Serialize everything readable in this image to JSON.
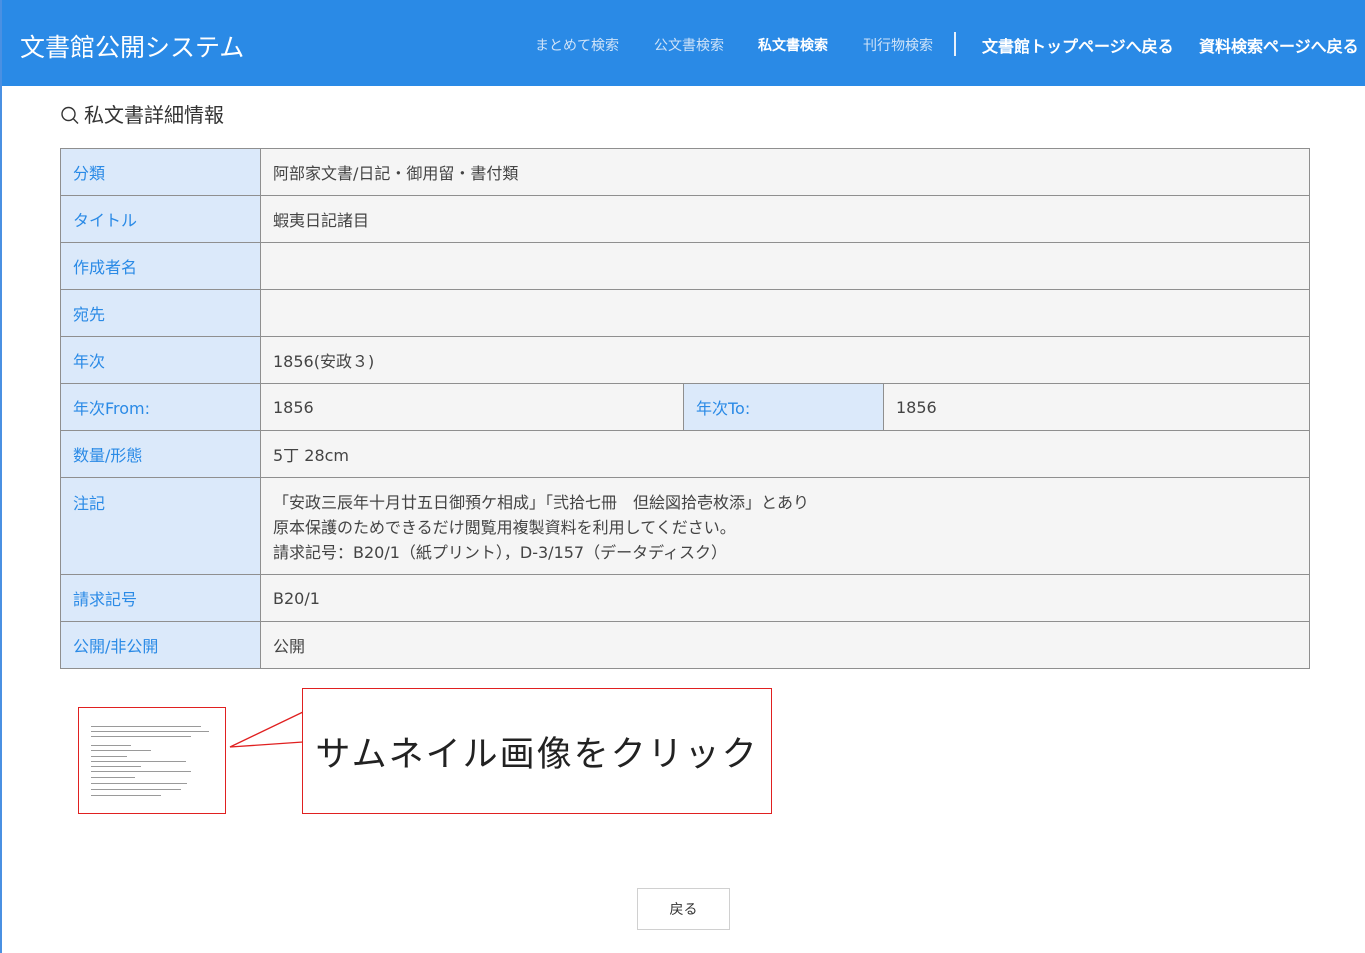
{
  "app": {
    "title": "文書館公開システム"
  },
  "nav": {
    "items": [
      {
        "label": "まとめて検索",
        "active": false
      },
      {
        "label": "公文書検索",
        "active": false
      },
      {
        "label": "私文書検索",
        "active": true
      },
      {
        "label": "刊行物検索",
        "active": false
      }
    ],
    "links": [
      {
        "label": "文書館トップページへ戻る"
      },
      {
        "label": "資料検索ページへ戻る"
      }
    ]
  },
  "page": {
    "title": "私文書詳細情報",
    "icon": "search-icon"
  },
  "detail": {
    "rows": [
      {
        "key": "分類",
        "value": "阿部家文書/日記・御用留・書付類"
      },
      {
        "key": "タイトル",
        "value": "蝦夷日記諸目"
      },
      {
        "key": "作成者名",
        "value": ""
      },
      {
        "key": "宛先",
        "value": ""
      },
      {
        "key": "年次",
        "value": "1856(安政３)"
      }
    ],
    "year_range": {
      "from_key": "年次From:",
      "from_value": "1856",
      "to_key": "年次To:",
      "to_value": "1856"
    },
    "rows2": [
      {
        "key": "数量/形態",
        "value": "5丁 28cm"
      }
    ],
    "note": {
      "key": "注記",
      "lines": [
        "「安政三辰年十月廿五日御預ケ相成」「弐拾七冊　但絵図拾壱枚添」とあり",
        "原本保護のためできるだけ閲覧用複製資料を利用してください。",
        "請求記号：B20/1（紙プリント），D-3/157（データディスク）"
      ]
    },
    "rows3": [
      {
        "key": "請求記号",
        "value": "B20/1"
      },
      {
        "key": "公開/非公開",
        "value": "公開"
      }
    ]
  },
  "thumbnail": {
    "callout": "サムネイル画像をクリック"
  },
  "actions": {
    "back_label": "戻る"
  },
  "colors": {
    "header": "#2a8ae6",
    "key_bg": "#dbe9fa",
    "value_bg": "#f5f5f5",
    "callout_border": "#e02020"
  }
}
